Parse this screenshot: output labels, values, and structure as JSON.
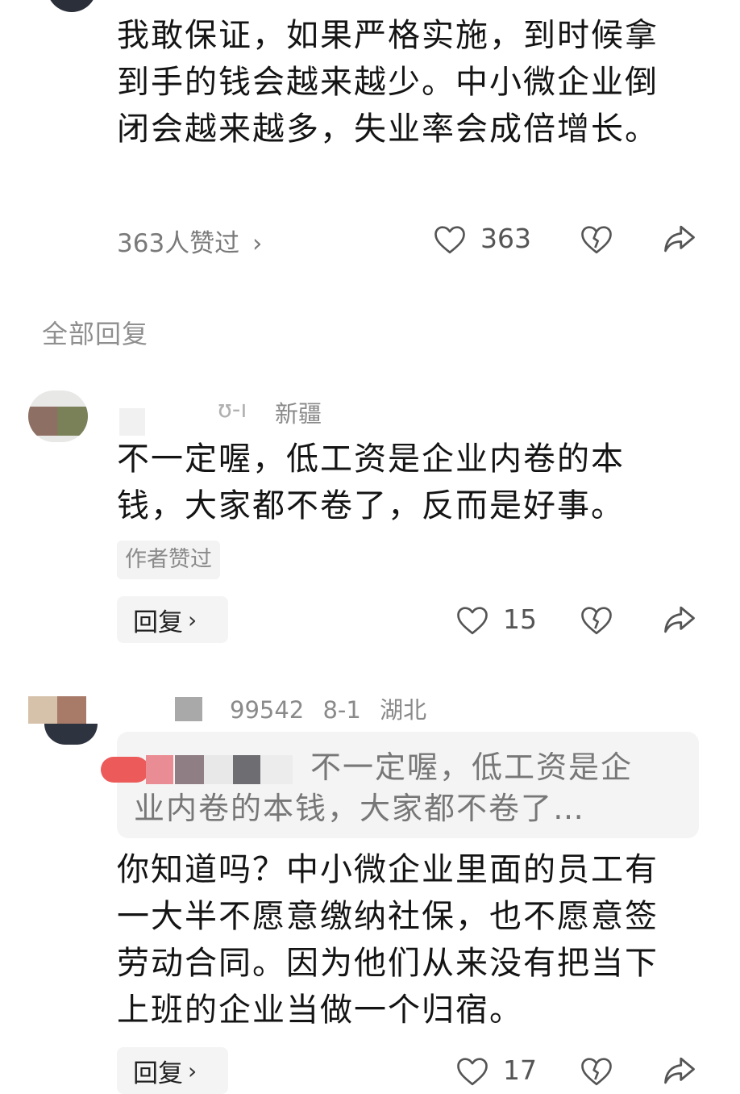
{
  "top_comment": {
    "text": "我敢保证，如果严格实施，到时候拿到手的钱会越来越少。中小微企业倒闭会越来越多，失业率会成倍增长。",
    "likes_summary": "363人赞过",
    "likes_chevron": "›",
    "like_count": "363"
  },
  "section": {
    "title": "全部回复"
  },
  "reply1": {
    "username_partial": "ʊ-ı",
    "location": "新疆",
    "text": "不一定喔，低工资是企业内卷的本钱，大家都不卷了，反而是好事。",
    "author_tag": "作者赞过",
    "reply_label": "回复",
    "reply_chevron": "›",
    "like_count": "15"
  },
  "reply2": {
    "username_partial": "99542",
    "date": "8-1",
    "location": "湖北",
    "quote_line1": "不一定喔，低工资是企",
    "quote_line2": "业内卷的本钱，大家都不卷了…",
    "text": "你知道吗？中小微企业里面的员工有一大半不愿意缴纳社保，也不愿意签劳动合同。因为他们从来没有把当下上班的企业当做一个归宿。",
    "reply_label": "回复",
    "reply_chevron": "›",
    "like_count": "17"
  },
  "icons": {
    "like": "heart-outline-icon",
    "dislike": "broken-heart-icon",
    "share": "share-arrow-icon"
  },
  "colors": {
    "text": "#141414",
    "muted": "#8a8a8a",
    "chip_bg": "#f4f4f4"
  }
}
